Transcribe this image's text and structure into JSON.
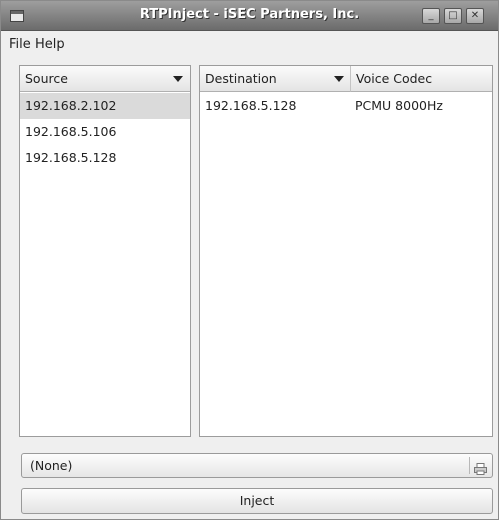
{
  "window": {
    "title": "RTPInject - iSEC Partners, Inc.",
    "minimize_glyph": "_",
    "maximize_glyph": "□",
    "close_glyph": "✕"
  },
  "menu": {
    "file": "File",
    "help": "Help"
  },
  "source_list": {
    "header": "Source",
    "items": [
      "192.168.2.102",
      "192.168.5.106",
      "192.168.5.128"
    ],
    "selected_index": 0
  },
  "destination_list": {
    "columns": [
      "Destination",
      "Voice Codec"
    ],
    "rows": [
      {
        "destination": "192.168.5.128",
        "codec": "PCMU 8000Hz"
      }
    ]
  },
  "file_selector": {
    "value": "(None)",
    "icon": "printer-icon"
  },
  "actions": {
    "inject_label": "Inject"
  }
}
